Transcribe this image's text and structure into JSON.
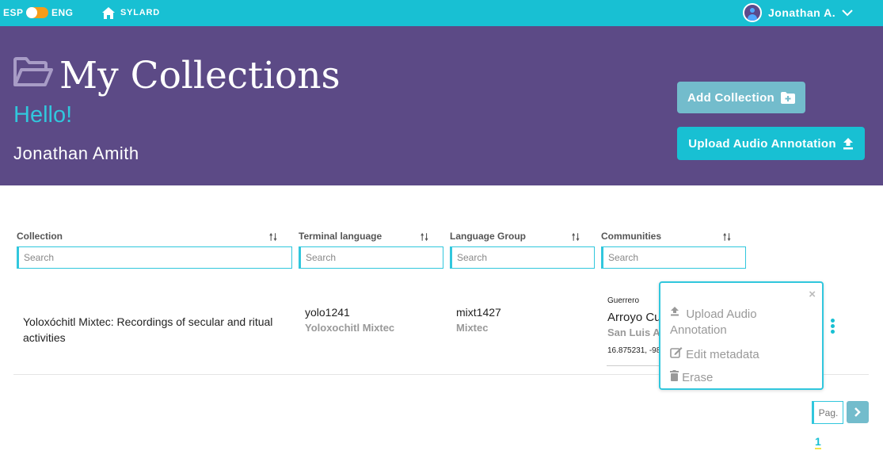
{
  "topbar": {
    "lang_left": "ESP",
    "lang_right": "ENG",
    "home_label": "SYLARD",
    "user_name": "Jonathan A."
  },
  "header": {
    "title": "My Collections",
    "greeting": "Hello!",
    "name": "Jonathan Amith",
    "add_collection_label": "Add Collection",
    "upload_label": "Upload Audio Annotation"
  },
  "table": {
    "columns": [
      {
        "label": "Collection",
        "search_placeholder": "Search"
      },
      {
        "label": "Terminal language",
        "search_placeholder": "Search"
      },
      {
        "label": "Language Group",
        "search_placeholder": "Search"
      },
      {
        "label": "Communities",
        "search_placeholder": "Search"
      }
    ],
    "rows": [
      {
        "collection": "Yoloxóchitl Mixtec: Recordings of secular and ritual activities",
        "terminal_code": "yolo1241",
        "terminal_name": "Yoloxochitl Mixtec",
        "group_code": "mixt1427",
        "group_name": "Mixtec",
        "community_state": "Guerrero",
        "community_name": "Arroyo Cu",
        "community_muni": "San Luis Ac",
        "community_coords": "16.875231, -98"
      }
    ]
  },
  "popup": {
    "close": "×",
    "upload_line1": "Upload Audio",
    "upload_line2": "Annotation",
    "edit": "Edit metadata",
    "erase": "Erase"
  },
  "pagination": {
    "placeholder": "Pag.",
    "current_page": "1"
  },
  "colors": {
    "topbar": "#18c0d3",
    "header": "#5c4a86",
    "accent": "#31c7dd",
    "toggle": "#f59c1a"
  }
}
